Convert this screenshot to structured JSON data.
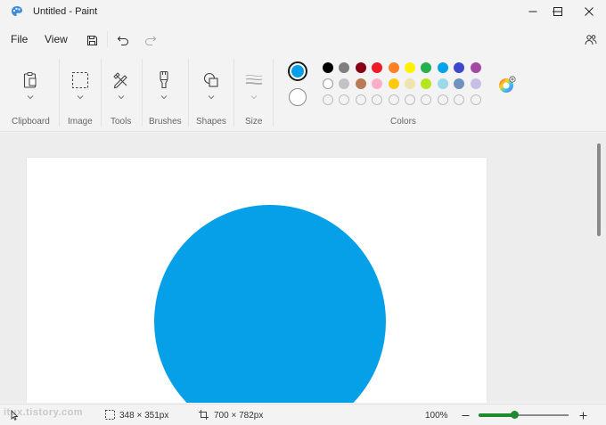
{
  "window": {
    "title": "Untitled - Paint"
  },
  "menu": {
    "file": "File",
    "view": "View"
  },
  "ribbon": {
    "clipboard": "Clipboard",
    "image": "Image",
    "tools": "Tools",
    "brushes": "Brushes",
    "shapes": "Shapes",
    "size": "Size",
    "colors": "Colors"
  },
  "colors": {
    "primary": "#06a0e8",
    "secondary": "#ffffff",
    "row1": [
      "#000000",
      "#7f7f7f",
      "#880015",
      "#ed1c24",
      "#ff7f27",
      "#fff200",
      "#22b14c",
      "#00a2e8",
      "#3f48cc",
      "#a349a4"
    ],
    "row2": [
      "#ffffff",
      "#c3c3c3",
      "#b97a57",
      "#ffaec9",
      "#ffc90e",
      "#efe4b0",
      "#b5e61d",
      "#99d9ea",
      "#7092be",
      "#c8bfe7"
    ],
    "row3_empty_count": 10,
    "shape_fill": "#06a0e8"
  },
  "status": {
    "watermark": "itux.tistory.com",
    "selection_size": "348 × 351px",
    "canvas_size": "700 × 782px",
    "zoom": "100%",
    "zoom_level": 0.4
  }
}
